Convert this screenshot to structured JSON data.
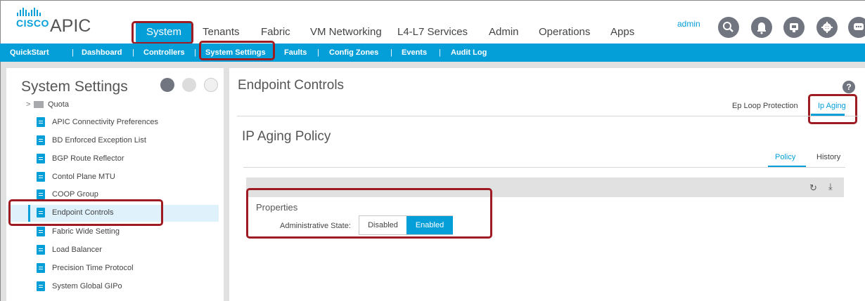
{
  "brand": {
    "logo_text": "CISCO",
    "app_name": "APIC"
  },
  "top_nav": {
    "items": [
      "System",
      "Tenants",
      "Fabric",
      "VM Networking",
      "L4-L7 Services",
      "Admin",
      "Operations",
      "Apps"
    ]
  },
  "user": {
    "name": "admin"
  },
  "header_icons": [
    "search-icon",
    "bell-icon",
    "feedback-icon",
    "gear-icon",
    "chat-icon"
  ],
  "sub_nav": {
    "items": [
      "QuickStart",
      "Dashboard",
      "Controllers",
      "System Settings",
      "Faults",
      "Config Zones",
      "Events",
      "Audit Log"
    ]
  },
  "left_panel": {
    "title": "System Settings",
    "tree": [
      "Quota",
      "APIC Connectivity Preferences",
      "BD Enforced Exception List",
      "BGP Route Reflector",
      "Contol Plane MTU",
      "COOP Group",
      "Endpoint Controls",
      "Fabric Wide Setting",
      "Load Balancer",
      "Precision Time Protocol",
      "System Global GIPo"
    ]
  },
  "main": {
    "title": "Endpoint Controls",
    "tabs": [
      "Ep Loop Protection",
      "Ip Aging"
    ],
    "policy_title": "IP Aging Policy",
    "policy_tabs": [
      "Policy",
      "History"
    ],
    "properties_label": "Properties",
    "admin_state_label": "Administrative State:",
    "admin_state_options": [
      "Disabled",
      "Enabled"
    ],
    "admin_state_selected": "Enabled",
    "help_glyph": "?"
  },
  "colors": {
    "accent": "#049fd9",
    "highlight_box": "#9e1b22",
    "icon_gray": "#707580"
  }
}
